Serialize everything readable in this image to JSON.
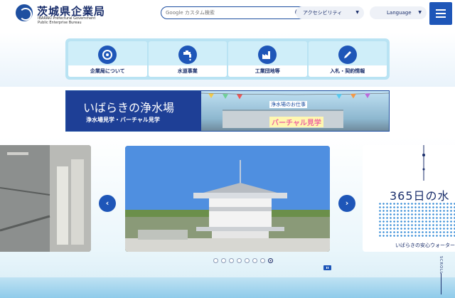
{
  "header": {
    "site_title": "茨城県企業局",
    "site_subtitle_line1": "IBARAKI Prefectural Government",
    "site_subtitle_line2": "Public Enterprise Bureau",
    "search_placeholder": "Google カスタム検索",
    "accessibility_label": "アクセシビリティ",
    "language_label": "Language"
  },
  "nav": {
    "items": [
      {
        "label": "企業局について",
        "icon": "building-logo-icon"
      },
      {
        "label": "水道事業",
        "icon": "faucet-icon"
      },
      {
        "label": "工業団地等",
        "icon": "factory-icon"
      },
      {
        "label": "入札・契約情報",
        "icon": "pen-icon"
      }
    ]
  },
  "banner": {
    "title": "いばらきの浄水場",
    "subtitle": "浄水場見学・バーチャル見学",
    "tag_small": "浄水場のお仕事",
    "tag_large": "バーチャル見学"
  },
  "carousel": {
    "right_slide_title": "365日の水",
    "right_slide_caption": "いばらきの安心ウォーター",
    "prev_icon": "‹",
    "next_icon": "›",
    "slide_count": 8,
    "active_index": 7
  },
  "scroll_label": "SCROLL",
  "colors": {
    "brand": "#1e56b8",
    "navy": "#1a2e6b",
    "nav_bg": "#b9e3f3"
  }
}
